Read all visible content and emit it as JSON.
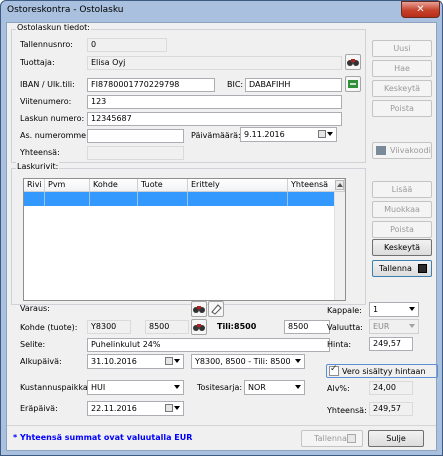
{
  "window": {
    "title": "Ostoreskontra - Ostolasku",
    "close_glyph": "✕"
  },
  "header_group": {
    "title": "Ostolaskun tiedot:",
    "fields": {
      "tallennusnro": {
        "label": "Tallennusnro:",
        "value": "0"
      },
      "tuottaja": {
        "label": "Tuottaja:",
        "value": "Elisa Oyj"
      },
      "iban": {
        "label": "IBAN / Ulk.tili:",
        "value": "FI8780001770229798"
      },
      "bic": {
        "label": "BIC:",
        "value": "DABAFIHH"
      },
      "viitenumero": {
        "label": "Viitenumero:",
        "value": "123"
      },
      "laskun_numero": {
        "label": "Laskun numero:",
        "value": "12345687"
      },
      "as_numeromme": {
        "label": "As. numeromme:",
        "value": ""
      },
      "paivamaara": {
        "label": "Päivämäärä:",
        "value": "9.11.2016"
      },
      "yhteensa": {
        "label": "Yhteensä:",
        "value": ""
      }
    }
  },
  "side_buttons": {
    "uusi": "Uusi",
    "hae": "Hae",
    "keskeyta": "Keskeytä",
    "poista": "Poista",
    "viivakoodi": "Viivakoodi"
  },
  "rows_group": {
    "title": "Laskurivit:",
    "columns": [
      "Rivi",
      "Pvm",
      "Kohde",
      "Tuote",
      "Erittely",
      "Yhteensä"
    ],
    "rows": [
      [
        "",
        "",
        "",
        "",
        "",
        ""
      ]
    ]
  },
  "row_buttons": {
    "lisaa": "Lisää",
    "muokkaa": "Muokkaa",
    "poista": "Poista",
    "keskeyta": "Keskeytä",
    "tallenna": "Tallenna"
  },
  "row_form": {
    "varaus": {
      "label": "Varaus:"
    },
    "kohde": {
      "label": "Kohde (tuote):",
      "code": "Y8300",
      "number": "8500",
      "tili_label": "Tili:",
      "tili_value": "8500",
      "right_value": "8500"
    },
    "selite": {
      "label": "Selite:",
      "value": "Puhelinkulut 24%"
    },
    "alkupaiva": {
      "label": "Alkupäivä:",
      "value": "31.10.2016",
      "combo": "Y8300, 8500 - Tili: 8500"
    },
    "kustannuspaikka": {
      "label": "Kustannuspaikka:",
      "value": "HUI"
    },
    "tositesarja": {
      "label": "Tositesarja:",
      "value": "NOR"
    },
    "erapaiva": {
      "label": "Eräpäivä:",
      "value": "22.11.2016"
    },
    "kappale": {
      "label": "Kappale:",
      "value": "1"
    },
    "valuutta": {
      "label": "Valuutta:",
      "value": "EUR"
    },
    "hinta": {
      "label": "Hinta:",
      "value": "249,57"
    },
    "vero": {
      "label": "Vero sisältyy hintaan",
      "checked": true
    },
    "alv": {
      "label": "Alv%:",
      "value": "24,00"
    },
    "yhteensa": {
      "label": "Yhteensä:",
      "value": "249,57"
    }
  },
  "footer": {
    "note": "* Yhteensä summat ovat valuutalla EUR",
    "tallenna": "Tallenna",
    "sulje": "Sulje"
  },
  "colors": {
    "accent_blue": "#0000ff",
    "selection": "#3399ff"
  }
}
